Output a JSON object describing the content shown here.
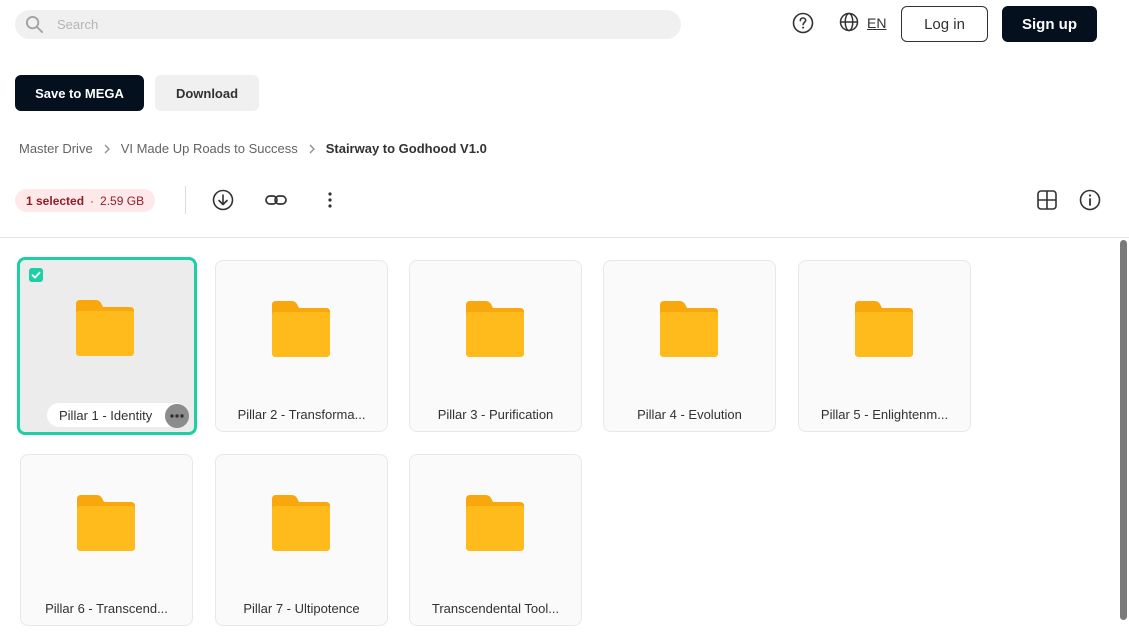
{
  "search": {
    "placeholder": "Search"
  },
  "header": {
    "lang": "EN",
    "login_label": "Log in",
    "signup_label": "Sign up"
  },
  "actions": {
    "save_label": "Save to MEGA",
    "download_label": "Download"
  },
  "breadcrumb": {
    "items": [
      "Master Drive",
      "VI Made Up Roads to Success"
    ],
    "current": "Stairway to Godhood V1.0"
  },
  "selection": {
    "count_label": "1 selected",
    "size": "2.59 GB"
  },
  "colors": {
    "accent": "#1dcfa5",
    "folder": "#ffb71b",
    "dark": "#04101e",
    "badge_bg": "#fde9ea",
    "badge_text": "#961c26"
  },
  "files": [
    {
      "name": "Pillar 1 - Identity",
      "selected": true
    },
    {
      "name": "Pillar 2 - Transforma...",
      "selected": false
    },
    {
      "name": "Pillar 3 - Purification",
      "selected": false
    },
    {
      "name": "Pillar 4 - Evolution",
      "selected": false
    },
    {
      "name": "Pillar 5 - Enlightenm...",
      "selected": false
    },
    {
      "name": "Pillar 6 - Transcend...",
      "selected": false
    },
    {
      "name": "Pillar 7 - Ultipotence",
      "selected": false
    },
    {
      "name": "Transcendental Tool...",
      "selected": false
    }
  ]
}
